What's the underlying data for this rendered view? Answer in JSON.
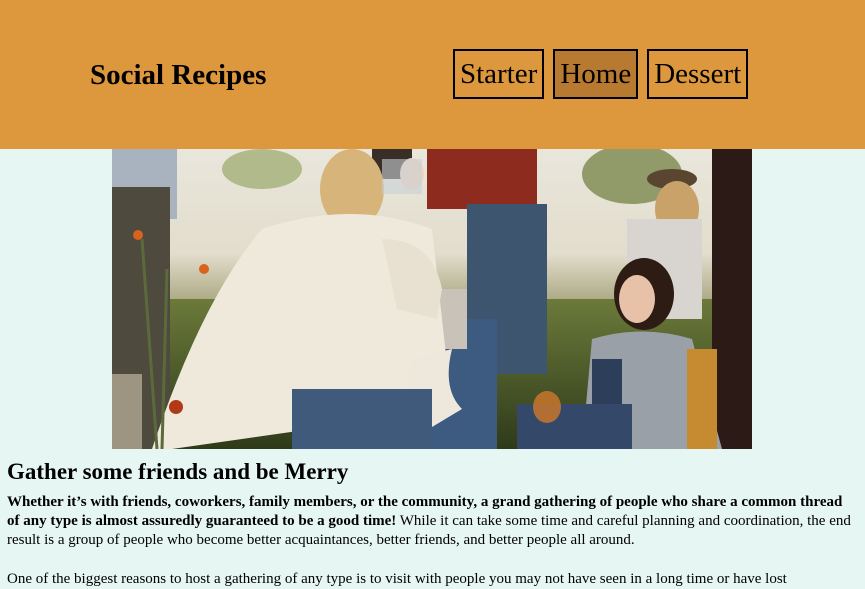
{
  "header": {
    "brand": "Social Recipes",
    "nav": [
      {
        "label": "Starter",
        "active": false
      },
      {
        "label": "Home",
        "active": true
      },
      {
        "label": "Dessert",
        "active": false
      }
    ],
    "background": "#dd973c",
    "active_background": "#b87a30"
  },
  "hero": {
    "alt": "Group of friends outdoors sharing drinks"
  },
  "article": {
    "heading": "Gather some friends and be Merry",
    "p1_bold": "Whether it’s with friends, coworkers, family members, or the community, a grand gathering of people who share a common thread of any type is almost assuredly guaranteed to be a good time!",
    "p1_rest": " While it can take some time and careful planning and coordination, the end result is a group of people who become better acquaintances, better friends, and better people all around.",
    "p2": "One of the biggest reasons to host a gathering of any type is to visit with people you may not have seen in a long time or have lost"
  },
  "colors": {
    "page_bg": "#e6f6f2"
  }
}
